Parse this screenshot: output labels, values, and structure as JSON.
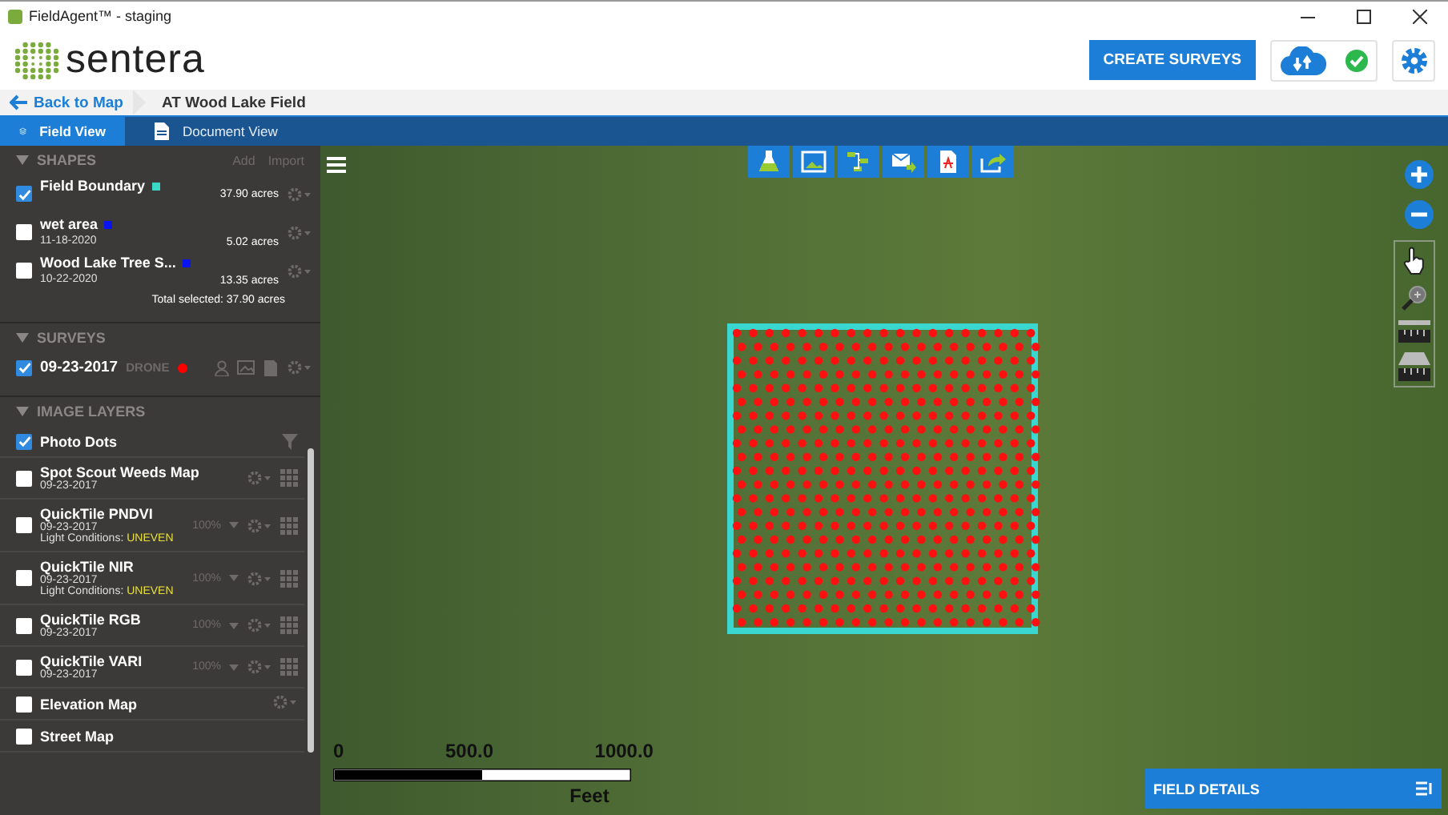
{
  "window": {
    "title": "FieldAgent™ - staging"
  },
  "header": {
    "logo": "sentera",
    "create_button": "CREATE SURVEYS",
    "sync_ok": true
  },
  "breadcrumb": {
    "back": "Back to Map",
    "field": "AT Wood Lake Field"
  },
  "tabs": [
    {
      "label": "Field View",
      "selected": true
    },
    {
      "label": "Document View",
      "selected": false
    }
  ],
  "shapes": {
    "title": "SHAPES",
    "expanded": true,
    "actions": [
      "Add",
      "Import"
    ],
    "total": "Total selected: 37.90 acres",
    "items": [
      {
        "name": "Field Boundary",
        "area": "37.90 acres",
        "color": "#3ad6c6",
        "checked": true
      },
      {
        "name": "wet area",
        "date": "11-18-2020",
        "area": "5.02 acres",
        "color": "#0a14f0",
        "checked": false
      },
      {
        "name": "Wood Lake Tree S...",
        "date": "10-22-2020",
        "area": "13.35 acres",
        "color": "#0a14f0",
        "checked": false
      }
    ]
  },
  "surveys": {
    "title": "SURVEYS",
    "expanded": true,
    "items": [
      {
        "date": "09-23-2017",
        "type": "DRONE",
        "color": "#ff0000",
        "checked": true
      }
    ]
  },
  "image_layers": {
    "title": "IMAGE LAYERS",
    "expanded": true,
    "items": [
      {
        "kind": "dots",
        "name": "Photo Dots",
        "checked": true
      },
      {
        "kind": "map",
        "name": "Spot Scout Weeds Map",
        "date": "09-23-2017",
        "checked": false
      },
      {
        "kind": "tile",
        "name": "QuickTile PNDVI",
        "date": "09-23-2017",
        "opacity": "100%",
        "light_label": "Light Conditions:",
        "light_value": "UNEVEN",
        "checked": false
      },
      {
        "kind": "tile",
        "name": "QuickTile NIR",
        "date": "09-23-2017",
        "opacity": "100%",
        "light_label": "Light Conditions:",
        "light_value": "UNEVEN",
        "checked": false
      },
      {
        "kind": "tile",
        "name": "QuickTile RGB",
        "date": "09-23-2017",
        "opacity": "100%",
        "checked": false
      },
      {
        "kind": "tile",
        "name": "QuickTile VARI",
        "date": "09-23-2017",
        "opacity": "100%",
        "checked": false
      },
      {
        "kind": "base",
        "name": "Elevation Map",
        "checked": false,
        "settings": true
      },
      {
        "kind": "base",
        "name": "Street Map",
        "checked": false,
        "settings": false
      }
    ]
  },
  "map": {
    "scale_labels": [
      "0",
      "500.0",
      "1000.0"
    ],
    "scale_unit": "Feet",
    "field_details": "FIELD DETAILS"
  }
}
